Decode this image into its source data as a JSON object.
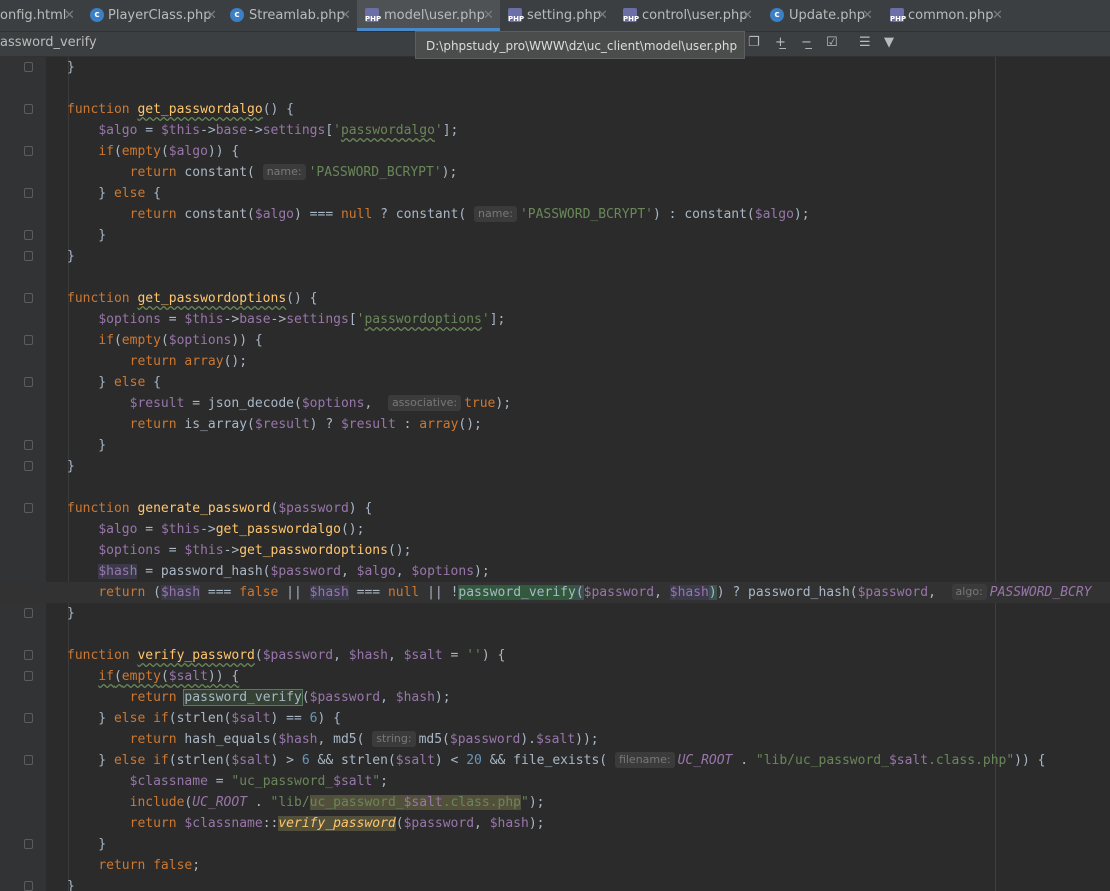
{
  "tabs": [
    {
      "label": "onfig.html",
      "icon": "html-icon"
    },
    {
      "label": "PlayerClass.php",
      "icon": "class-icon"
    },
    {
      "label": "Streamlab.php",
      "icon": "class-icon"
    },
    {
      "label": "model\\user.php",
      "icon": "php-icon",
      "active": true
    },
    {
      "label": "setting.php",
      "icon": "php-icon"
    },
    {
      "label": "control\\user.php",
      "icon": "php-icon"
    },
    {
      "label": "Update.php",
      "icon": "class-icon"
    },
    {
      "label": "common.php",
      "icon": "php-icon"
    }
  ],
  "breadcrumb": "assword_verify",
  "tooltip": "D:\\phpstudy_pro\\WWW\\dz\\uc_client\\model\\user.php",
  "code_lines": [
    "    }",
    "",
    "    function get_passwordalgo() {",
    "        $algo = $this->base->settings['passwordalgo'];",
    "        if(empty($algo)) {",
    "            return constant( name: 'PASSWORD_BCRYPT');",
    "        } else {",
    "            return constant($algo) === null ? constant( name: 'PASSWORD_BCRYPT') : constant($algo);",
    "        }",
    "    }",
    "",
    "    function get_passwordoptions() {",
    "        $options = $this->base->settings['passwordoptions'];",
    "        if(empty($options)) {",
    "            return array();",
    "        } else {",
    "            $result = json_decode($options,  associative: true);",
    "            return is_array($result) ? $result : array();",
    "        }",
    "    }",
    "",
    "    function generate_password($password) {",
    "        $algo = $this->get_passwordalgo();",
    "        $options = $this->get_passwordoptions();",
    "        $hash = password_hash($password, $algo, $options);",
    "        return ($hash === false || $hash === null || !password_verify($password, $hash)) ? password_hash($password,  algo: PASSWORD_BCRY",
    "    }",
    "",
    "    function verify_password($password, $hash, $salt = '') {",
    "        if(empty($salt)) {",
    "            return password_verify($password, $hash);",
    "        } else if(strlen($salt) == 6) {",
    "            return hash_equals($hash, md5( string: md5($password).$salt));",
    "        } else if(strlen($salt) > 6 && strlen($salt) < 20 && file_exists( filename: UC_ROOT . \"lib/uc_password_$salt.class.php\")) {",
    "            $classname = \"uc_password_$salt\";",
    "            include(UC_ROOT . \"lib/uc_password_$salt.class.php\");",
    "            return $classname::verify_password($password, $hash);",
    "        }",
    "        return false;",
    "    }"
  ]
}
